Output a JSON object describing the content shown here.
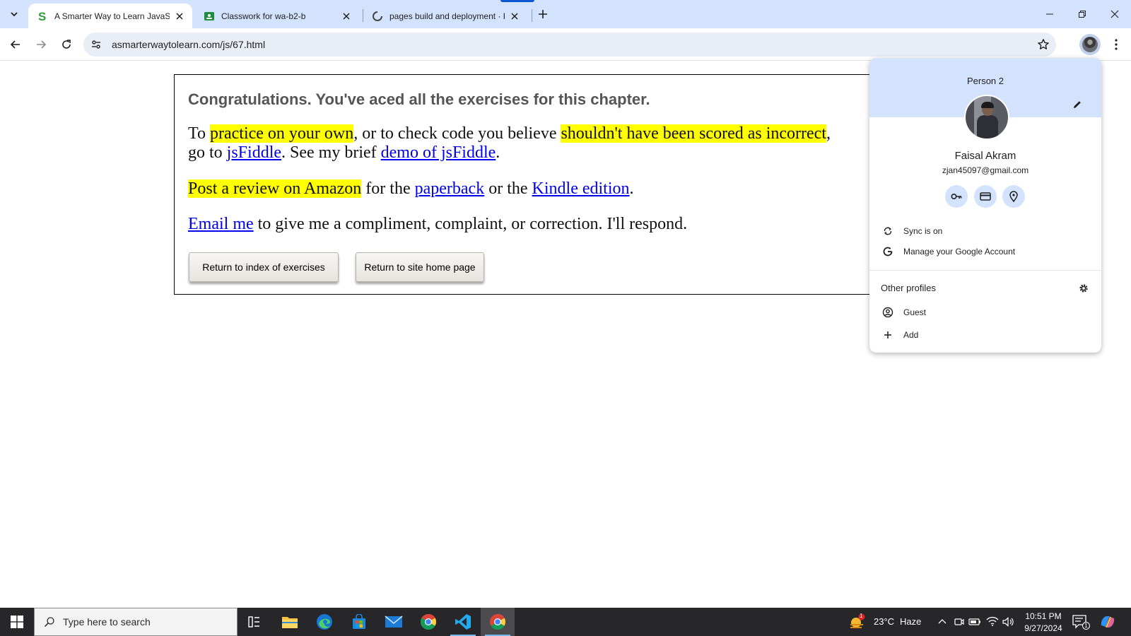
{
  "tabs": [
    {
      "title": "A Smarter Way to Learn JavaScr",
      "active": true
    },
    {
      "title": "Classwork for wa-b2-b",
      "active": false
    },
    {
      "title": "pages build and deployment · F",
      "active": false
    }
  ],
  "address_bar": {
    "url": "asmarterwaytolearn.com/js/67.html"
  },
  "page": {
    "heading": "Congratulations. You've aced all the exercises for this chapter.",
    "p1": {
      "t1": "To ",
      "h1": "practice on your own",
      "t2": ", or to check code you believe ",
      "h2": "shouldn't have been scored as incorrect",
      "t3": ", go to ",
      "l1": "jsFiddle",
      "t4": ". See my brief ",
      "l2": "demo of jsFiddle",
      "t5": "."
    },
    "p2": {
      "h1": "Post a review on Amazon",
      "t1": " for the ",
      "l1": "paperback",
      "t2": " or the ",
      "l2": "Kindle edition",
      "t3": "."
    },
    "p3": {
      "l1": "Email me",
      "t1": " to give me a compliment, complaint, or correction. I'll respond."
    },
    "buttons": {
      "index": "Return to index of exercises",
      "home": "Return to site home page"
    }
  },
  "profile_menu": {
    "profile_label": "Person 2",
    "name": "Faisal Akram",
    "email": "zjan45097@gmail.com",
    "sync": "Sync is on",
    "manage": "Manage your Google Account",
    "other_profiles": "Other profiles",
    "guest": "Guest",
    "add": "Add"
  },
  "taskbar": {
    "search_placeholder": "Type here to search",
    "weather": {
      "temp": "23°C",
      "condition": "Haze",
      "badge": "1"
    },
    "time": "10:51 PM",
    "date": "9/27/2024",
    "notification_count": "1"
  },
  "colors": {
    "tabstrip": "#d3e3fd",
    "highlight": "#ffff00",
    "link": "#0000ee",
    "taskbar": "#27272a"
  }
}
